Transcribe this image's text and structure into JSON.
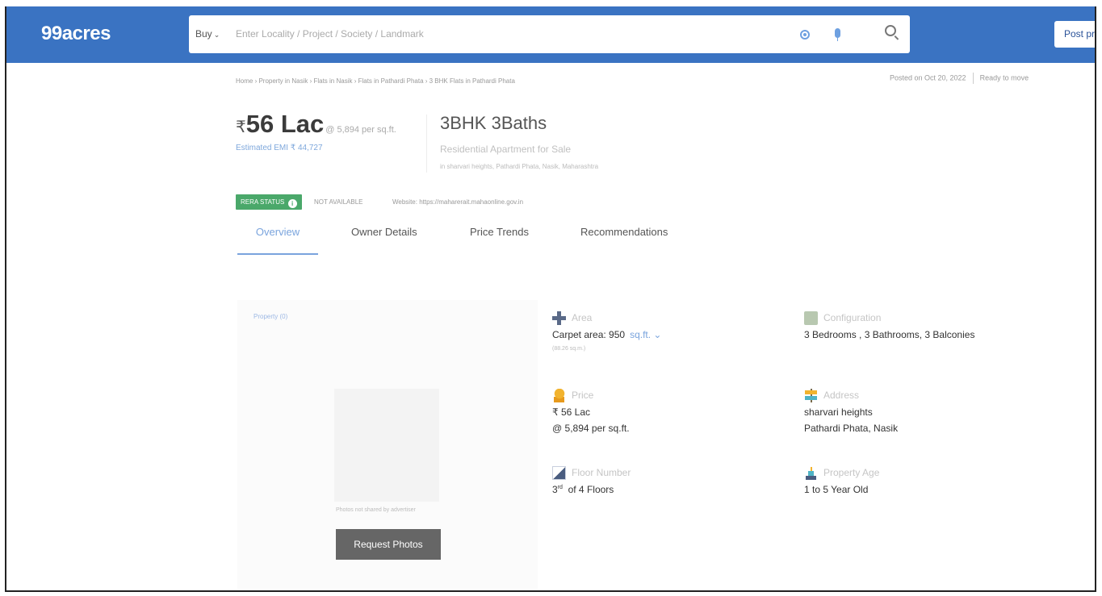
{
  "header": {
    "logo": "99acres",
    "buy_label": "Buy",
    "search_placeholder": "Enter Locality / Project / Society / Landmark",
    "post_button": "Post property"
  },
  "breadcrumb": "Home › Property in Nasik › Flats in Nasik › Flats in Pathardi Phata › 3 BHK Flats in Pathardi Phata",
  "posted": {
    "date": "Posted on Oct 20, 2022",
    "status": "Ready to move"
  },
  "price": {
    "amount": "56 Lac",
    "per_sqft": "@ 5,894 per sq.ft.",
    "emi": "Estimated EMI ₹ 44,727"
  },
  "property": {
    "config": "3BHK 3Baths",
    "type": "Residential Apartment for Sale",
    "location": "in sharvari heights, Pathardi Phata, Nasik, Maharashtra"
  },
  "rera": {
    "badge": "RERA STATUS",
    "status": "NOT AVAILABLE",
    "website": "Website: https://maharerait.mahaonline.gov.in"
  },
  "tabs": [
    "Overview",
    "Owner Details",
    "Price Trends",
    "Recommendations"
  ],
  "photos": {
    "label": "Property (0)",
    "caption": "Photos not shared by advertiser",
    "button": "Request Photos"
  },
  "details": {
    "area": {
      "label": "Area",
      "value": "Carpet area: 950",
      "unit": "sq.ft.",
      "sub": "(88.26 sq.m.)"
    },
    "configuration": {
      "label": "Configuration",
      "value": "3 Bedrooms , 3 Bathrooms, 3 Balconies"
    },
    "price": {
      "label": "Price",
      "value": "₹ 56 Lac",
      "sub": "@ 5,894 per sq.ft."
    },
    "address": {
      "label": "Address",
      "line1": "sharvari heights",
      "line2": "Pathardi Phata, Nasik"
    },
    "floor": {
      "label": "Floor Number",
      "floor_num": "3",
      "suffix": "rd",
      "of": "of 4 Floors"
    },
    "age": {
      "label": "Property Age",
      "value": "1 to 5 Year Old"
    }
  }
}
